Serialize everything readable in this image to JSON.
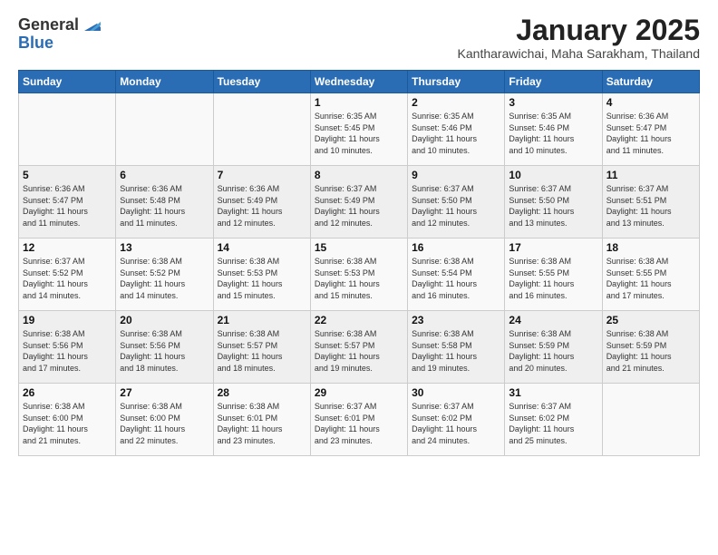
{
  "logo": {
    "general": "General",
    "blue": "Blue"
  },
  "header": {
    "month": "January 2025",
    "location": "Kantharawichai, Maha Sarakham, Thailand"
  },
  "weekdays": [
    "Sunday",
    "Monday",
    "Tuesday",
    "Wednesday",
    "Thursday",
    "Friday",
    "Saturday"
  ],
  "weeks": [
    [
      {
        "day": "",
        "info": ""
      },
      {
        "day": "",
        "info": ""
      },
      {
        "day": "",
        "info": ""
      },
      {
        "day": "1",
        "info": "Sunrise: 6:35 AM\nSunset: 5:45 PM\nDaylight: 11 hours\nand 10 minutes."
      },
      {
        "day": "2",
        "info": "Sunrise: 6:35 AM\nSunset: 5:46 PM\nDaylight: 11 hours\nand 10 minutes."
      },
      {
        "day": "3",
        "info": "Sunrise: 6:35 AM\nSunset: 5:46 PM\nDaylight: 11 hours\nand 10 minutes."
      },
      {
        "day": "4",
        "info": "Sunrise: 6:36 AM\nSunset: 5:47 PM\nDaylight: 11 hours\nand 11 minutes."
      }
    ],
    [
      {
        "day": "5",
        "info": "Sunrise: 6:36 AM\nSunset: 5:47 PM\nDaylight: 11 hours\nand 11 minutes."
      },
      {
        "day": "6",
        "info": "Sunrise: 6:36 AM\nSunset: 5:48 PM\nDaylight: 11 hours\nand 11 minutes."
      },
      {
        "day": "7",
        "info": "Sunrise: 6:36 AM\nSunset: 5:49 PM\nDaylight: 11 hours\nand 12 minutes."
      },
      {
        "day": "8",
        "info": "Sunrise: 6:37 AM\nSunset: 5:49 PM\nDaylight: 11 hours\nand 12 minutes."
      },
      {
        "day": "9",
        "info": "Sunrise: 6:37 AM\nSunset: 5:50 PM\nDaylight: 11 hours\nand 12 minutes."
      },
      {
        "day": "10",
        "info": "Sunrise: 6:37 AM\nSunset: 5:50 PM\nDaylight: 11 hours\nand 13 minutes."
      },
      {
        "day": "11",
        "info": "Sunrise: 6:37 AM\nSunset: 5:51 PM\nDaylight: 11 hours\nand 13 minutes."
      }
    ],
    [
      {
        "day": "12",
        "info": "Sunrise: 6:37 AM\nSunset: 5:52 PM\nDaylight: 11 hours\nand 14 minutes."
      },
      {
        "day": "13",
        "info": "Sunrise: 6:38 AM\nSunset: 5:52 PM\nDaylight: 11 hours\nand 14 minutes."
      },
      {
        "day": "14",
        "info": "Sunrise: 6:38 AM\nSunset: 5:53 PM\nDaylight: 11 hours\nand 15 minutes."
      },
      {
        "day": "15",
        "info": "Sunrise: 6:38 AM\nSunset: 5:53 PM\nDaylight: 11 hours\nand 15 minutes."
      },
      {
        "day": "16",
        "info": "Sunrise: 6:38 AM\nSunset: 5:54 PM\nDaylight: 11 hours\nand 16 minutes."
      },
      {
        "day": "17",
        "info": "Sunrise: 6:38 AM\nSunset: 5:55 PM\nDaylight: 11 hours\nand 16 minutes."
      },
      {
        "day": "18",
        "info": "Sunrise: 6:38 AM\nSunset: 5:55 PM\nDaylight: 11 hours\nand 17 minutes."
      }
    ],
    [
      {
        "day": "19",
        "info": "Sunrise: 6:38 AM\nSunset: 5:56 PM\nDaylight: 11 hours\nand 17 minutes."
      },
      {
        "day": "20",
        "info": "Sunrise: 6:38 AM\nSunset: 5:56 PM\nDaylight: 11 hours\nand 18 minutes."
      },
      {
        "day": "21",
        "info": "Sunrise: 6:38 AM\nSunset: 5:57 PM\nDaylight: 11 hours\nand 18 minutes."
      },
      {
        "day": "22",
        "info": "Sunrise: 6:38 AM\nSunset: 5:57 PM\nDaylight: 11 hours\nand 19 minutes."
      },
      {
        "day": "23",
        "info": "Sunrise: 6:38 AM\nSunset: 5:58 PM\nDaylight: 11 hours\nand 19 minutes."
      },
      {
        "day": "24",
        "info": "Sunrise: 6:38 AM\nSunset: 5:59 PM\nDaylight: 11 hours\nand 20 minutes."
      },
      {
        "day": "25",
        "info": "Sunrise: 6:38 AM\nSunset: 5:59 PM\nDaylight: 11 hours\nand 21 minutes."
      }
    ],
    [
      {
        "day": "26",
        "info": "Sunrise: 6:38 AM\nSunset: 6:00 PM\nDaylight: 11 hours\nand 21 minutes."
      },
      {
        "day": "27",
        "info": "Sunrise: 6:38 AM\nSunset: 6:00 PM\nDaylight: 11 hours\nand 22 minutes."
      },
      {
        "day": "28",
        "info": "Sunrise: 6:38 AM\nSunset: 6:01 PM\nDaylight: 11 hours\nand 23 minutes."
      },
      {
        "day": "29",
        "info": "Sunrise: 6:37 AM\nSunset: 6:01 PM\nDaylight: 11 hours\nand 23 minutes."
      },
      {
        "day": "30",
        "info": "Sunrise: 6:37 AM\nSunset: 6:02 PM\nDaylight: 11 hours\nand 24 minutes."
      },
      {
        "day": "31",
        "info": "Sunrise: 6:37 AM\nSunset: 6:02 PM\nDaylight: 11 hours\nand 25 minutes."
      },
      {
        "day": "",
        "info": ""
      }
    ]
  ]
}
